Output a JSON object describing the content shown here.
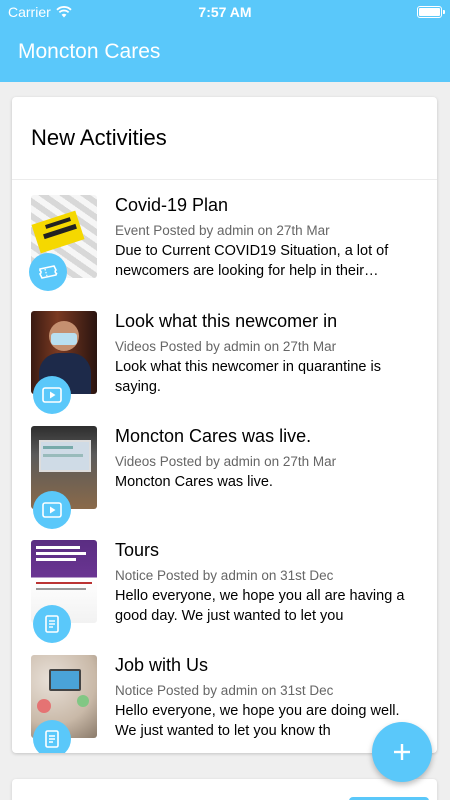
{
  "status": {
    "carrier": "Carrier",
    "time": "7:57 AM"
  },
  "app": {
    "title": "Moncton Cares"
  },
  "section": {
    "title": "New Activities"
  },
  "colors": {
    "accent": "#5ac8fa"
  },
  "activities": [
    {
      "title": "Covid-19 Plan",
      "meta": "Event Posted by admin on 27th Mar",
      "desc": "Due to Current COVID19 Situation, a lot of newcomers are looking for help in their…",
      "icon": "ticket-icon"
    },
    {
      "title": "Look what this newcomer in",
      "meta": "Videos Posted by admin on 27th Mar",
      "desc": "Look what this newcomer in quarantine is saying.",
      "icon": "video-icon"
    },
    {
      "title": "Moncton Cares was live.",
      "meta": "Videos Posted by admin on 27th Mar",
      "desc": "Moncton Cares was live.",
      "icon": "video-icon"
    },
    {
      "title": "Tours",
      "meta": "Notice Posted by admin on 31st Dec",
      "desc": "Hello everyone, we hope you all are having a good day. We just wanted to let you",
      "icon": "notice-icon"
    },
    {
      "title": "Job with Us",
      "meta": "Notice Posted by admin on 31st Dec",
      "desc": "Hello everyone, we hope you are doing well. We just wanted to let you know th",
      "icon": "notice-icon"
    }
  ]
}
